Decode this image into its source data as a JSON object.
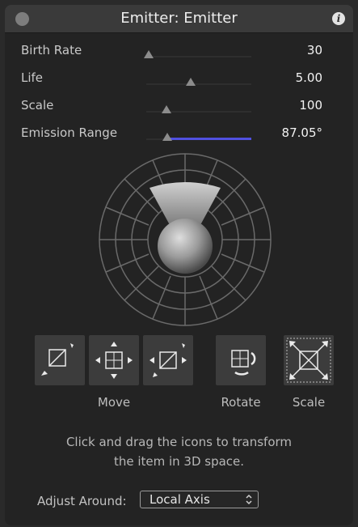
{
  "window": {
    "title": "Emitter: Emitter"
  },
  "params": [
    {
      "label": "Birth Rate",
      "value": "30",
      "level": 0.1
    },
    {
      "label": "Life",
      "value": "5.00",
      "level": 0.5
    },
    {
      "label": "Scale",
      "value": "100",
      "level": 0.25
    },
    {
      "label": "Emission Range",
      "value": "87.05°",
      "level": 0.24
    }
  ],
  "transform": {
    "move_label": "Move",
    "rotate_label": "Rotate",
    "scale_label": "Scale"
  },
  "hint": {
    "line1": "Click and drag the icons to transform",
    "line2": "the item in 3D space."
  },
  "adjust": {
    "label": "Adjust Around:",
    "value": "Local Axis"
  },
  "colors": {
    "accent": "#5050e0",
    "background": "#232323",
    "titlebar": "#3a3a3a"
  }
}
